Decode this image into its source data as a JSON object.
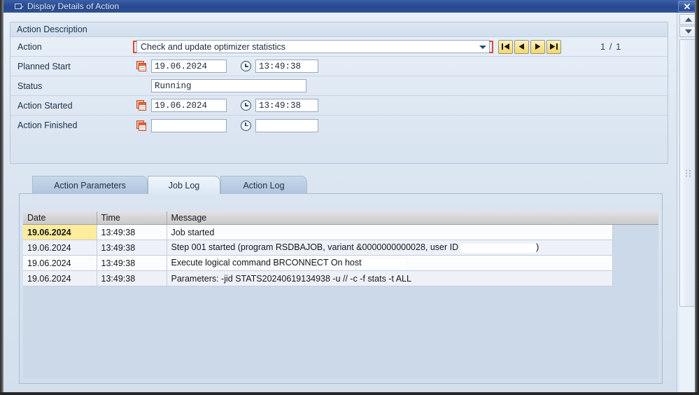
{
  "window": {
    "title": "Display Details of Action",
    "title_icon": "sap-window-icon",
    "close_label": "✕"
  },
  "group": {
    "title": "Action Description"
  },
  "form": {
    "action": {
      "label": "Action",
      "value": "Check and update optimizer statistics",
      "dropdown_icon": "chevron-down-icon"
    },
    "planned_start": {
      "label": "Planned Start",
      "date": "19.06.2024",
      "time": "13:49:38"
    },
    "status": {
      "label": "Status",
      "value": "Running"
    },
    "action_started": {
      "label": "Action Started",
      "date": "19.06.2024",
      "time": "13:49:38"
    },
    "action_finished": {
      "label": "Action Finished",
      "date": "",
      "time": ""
    }
  },
  "nav": {
    "first_icon": "first-record-icon",
    "prev_icon": "previous-record-icon",
    "next_icon": "next-record-icon",
    "last_icon": "last-record-icon",
    "page_counter": "1 / 1"
  },
  "tabs": [
    {
      "label": "Action Parameters",
      "active": false
    },
    {
      "label": "Job Log",
      "active": true
    },
    {
      "label": "Action Log",
      "active": false
    }
  ],
  "joblog": {
    "columns": [
      "Date",
      "Time",
      "Message"
    ],
    "rows": [
      {
        "date": "19.06.2024",
        "time": "13:49:38",
        "message": "Job started",
        "selected": true
      },
      {
        "date": "19.06.2024",
        "time": "13:49:38",
        "message": "Step 001 started (program RSDBAJOB, variant &0000000000028, user ID",
        "message_suffix": ")",
        "redacted": "user-id",
        "selected": false
      },
      {
        "date": "19.06.2024",
        "time": "13:49:38",
        "message": "Execute logical command BRCONNECT On host",
        "message_suffix": "",
        "redacted": "host",
        "selected": false
      },
      {
        "date": "19.06.2024",
        "time": "13:49:38",
        "message": "Parameters: -jid STATS20240619134938 -u // -c -f stats -t ALL",
        "selected": false
      }
    ]
  },
  "scrollbar": {
    "up_icon": "scroll-up-icon",
    "down_icon": "scroll-down-icon"
  },
  "colors": {
    "titlebar": "#2d4f96",
    "accent_focus": "#e04a33",
    "nav_button": "#f8e38d",
    "selected_cell": "#fcec9c",
    "panel_bg": "#d4e0ee"
  }
}
